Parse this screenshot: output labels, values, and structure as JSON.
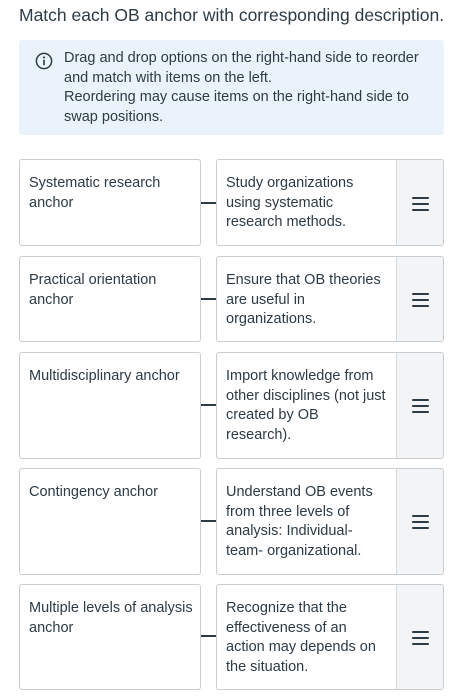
{
  "question": {
    "title": "Match each OB anchor with corresponding description."
  },
  "info": {
    "icon": "info-icon",
    "line1": "Drag and drop options on the right-hand side to reorder and match with items on the left.",
    "line2": "Reordering may cause items on the right-hand side to swap positions."
  },
  "pairs": [
    {
      "left": "Systematic research anchor",
      "right": "Study organizations using systematic research methods.",
      "handle_icon": "drag-handle-icon"
    },
    {
      "left": "Practical orientation anchor",
      "right": "Ensure that OB theories are useful in organizations.",
      "handle_icon": "drag-handle-icon"
    },
    {
      "left": "Multidisciplinary anchor",
      "right": "Import knowledge from other disciplines (not just created by OB research).",
      "handle_icon": "drag-handle-icon"
    },
    {
      "left": "Contingency anchor",
      "right": "Understand OB events from three levels of analysis: Individual-team- organizational.",
      "handle_icon": "drag-handle-icon"
    },
    {
      "left": "Multiple levels of analysis anchor",
      "right": "Recognize that the effectiveness of an action may depends on the situation.",
      "handle_icon": "drag-handle-icon"
    }
  ],
  "colors": {
    "text": "#2d3b45",
    "info_background": "#eaf2fb",
    "card_border": "#c7cdd1",
    "handle_background": "#f3f4f5"
  }
}
